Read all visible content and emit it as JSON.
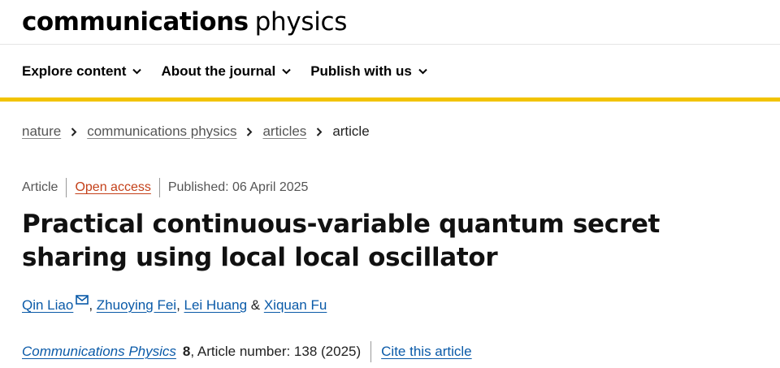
{
  "masthead": {
    "logo_bold": "communications",
    "logo_light": "physics"
  },
  "nav": {
    "items": [
      {
        "label": "Explore content"
      },
      {
        "label": "About the journal"
      },
      {
        "label": "Publish with us"
      }
    ]
  },
  "breadcrumb": {
    "items": [
      {
        "label": "nature"
      },
      {
        "label": "communications physics"
      },
      {
        "label": "articles"
      }
    ],
    "current": "article"
  },
  "article": {
    "type": "Article",
    "access": "Open access",
    "published": "Published: 06 April 2025",
    "title": "Practical continuous-variable quantum secret sharing using local local oscillator",
    "authors": [
      {
        "name": "Qin Liao"
      },
      {
        "name": "Zhuoying Fei"
      },
      {
        "name": "Lei Huang"
      },
      {
        "name": "Xiquan Fu"
      }
    ],
    "author_sep_comma": ", ",
    "author_sep_and": " & "
  },
  "citation": {
    "journal": "Communications Physics",
    "volume": "8",
    "article_number": ", Article number: 138 (2025)",
    "cite_label": "Cite this article"
  },
  "colors": {
    "accent_bar": "#f2c300",
    "link": "#0a5aa8",
    "open_access": "#c4411a"
  }
}
